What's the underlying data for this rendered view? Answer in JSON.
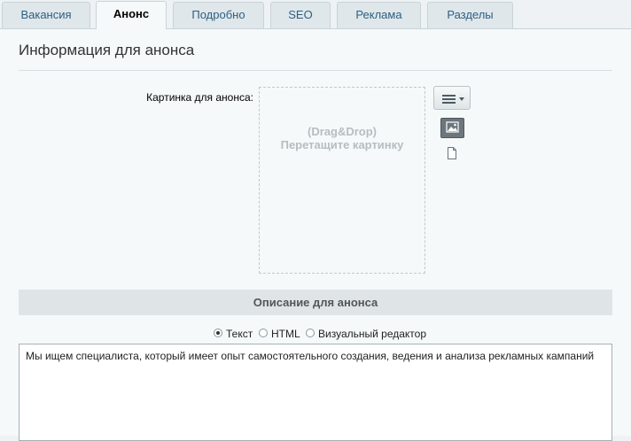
{
  "tabs": [
    {
      "label": "Вакансия",
      "active": false
    },
    {
      "label": "Анонс",
      "active": true
    },
    {
      "label": "Подробно",
      "active": false
    },
    {
      "label": "SEO",
      "active": false
    },
    {
      "label": "Реклама",
      "active": false
    },
    {
      "label": "Разделы",
      "active": false
    }
  ],
  "panel": {
    "title": "Информация для анонса",
    "image_field_label": "Картинка для анонса:",
    "dropzone_line1": "(Drag&Drop)",
    "dropzone_line2": "Перетащите картинку",
    "menu_button_icon": "menu-icon",
    "image_button_icon": "image-icon",
    "file_button_icon": "file-icon"
  },
  "description": {
    "header": "Описание для анонса",
    "options": [
      {
        "label": "Текст",
        "checked": true
      },
      {
        "label": "HTML",
        "checked": false
      },
      {
        "label": "Визуальный редактор",
        "checked": false
      }
    ],
    "text": "Мы ищем специалиста, который имеет опыт самостоятельного создания, ведения и анализа рекламных кампаний"
  },
  "colors": {
    "tab_text": "#2d5f82",
    "panel_bg": "#f5f9f9",
    "section_header_bg": "#dfe5e6"
  }
}
